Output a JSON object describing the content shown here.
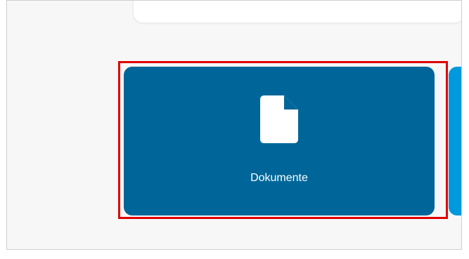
{
  "tiles": [
    {
      "label": "Dokumente",
      "icon": "document-icon",
      "color": "#006699"
    }
  ],
  "next_tile": {
    "color": "#0099dd"
  },
  "highlight": {
    "color": "#e00000"
  }
}
